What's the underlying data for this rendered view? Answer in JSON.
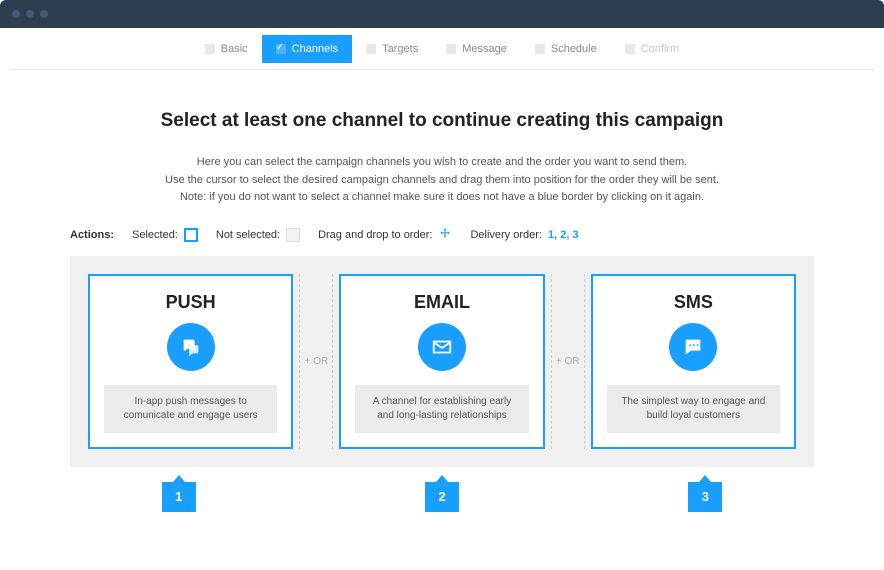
{
  "tabs": {
    "basic": "Basic",
    "channels": "Channels",
    "targets": "Targets",
    "message": "Message",
    "schedule": "Schedule",
    "confirm": "Confirm"
  },
  "page": {
    "title": "Select at least one channel to continue creating this campaign",
    "desc_l1": "Here you can select the campaign channels you wish to create and the order you want to send them.",
    "desc_l2": "Use the cursor to select the desired campaign channels and drag them into position for the order they will be sent.",
    "desc_l3": "Note: if you do not want to select a channel make sure it does not have a blue border by clicking on it again."
  },
  "actions": {
    "label": "Actions:",
    "selected": "Selected:",
    "not_selected": "Not selected:",
    "drag": "Drag and drop to order:",
    "delivery_label": "Delivery order:",
    "delivery_nums": "1, 2, 3"
  },
  "separator": "+ OR",
  "channels": {
    "push": {
      "title": "PUSH",
      "desc": "In-app push messages to comunicate and engage users",
      "order": "1"
    },
    "email": {
      "title": "EMAIL",
      "desc": "A channel for establishing early and long-lasting relationships",
      "order": "2"
    },
    "sms": {
      "title": "SMS",
      "desc": "The simplest way to engage and build loyal customers",
      "order": "3"
    }
  },
  "colors": {
    "accent": "#189fff"
  }
}
